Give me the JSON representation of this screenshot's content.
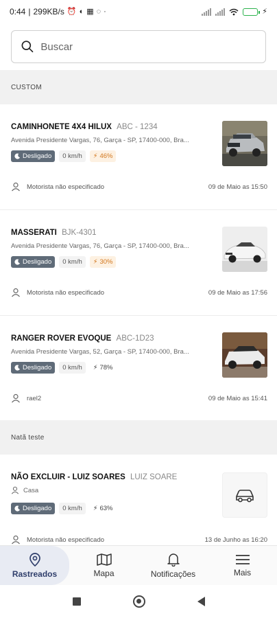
{
  "status_bar": {
    "time": "0:44",
    "net_speed": "299KB/s",
    "battery_level": 1.0,
    "icons": [
      "alarm-icon",
      "g-icon",
      "qr-icon",
      "whatsapp-icon",
      "dot-icon",
      "signal-icon",
      "signal-icon",
      "wifi-icon",
      "battery-icon",
      "charging-icon"
    ]
  },
  "search": {
    "placeholder": "Buscar",
    "value": ""
  },
  "groups": [
    {
      "label": "CUSTOM"
    },
    {
      "label": "Natã teste"
    }
  ],
  "vehicles": [
    {
      "name": "CAMINHONETE 4X4 HILUX",
      "plate": "ABC - 1234",
      "address": "Avenida Presidente Vargas, 76, Garça - SP, 17400-000, Bra...",
      "status": "Desligado",
      "speed": "0 km/h",
      "battery": "46%",
      "battery_low": true,
      "driver": "Motorista não especificado",
      "time": "09 de Maio as 15:50",
      "photo": "silver-pickup"
    },
    {
      "name": "MASSERATI",
      "plate": "BJK-4301",
      "address": "Avenida Presidente Vargas, 76, Garça - SP, 17400-000, Bra...",
      "status": "Desligado",
      "speed": "0 km/h",
      "battery": "30%",
      "battery_low": true,
      "driver": "Motorista não especificado",
      "time": "09 de Maio as 17:56",
      "photo": "white-sports-car"
    },
    {
      "name": "RANGER ROVER EVOQUE",
      "plate": "ABC-1D23",
      "address": "Avenida Presidente Vargas, 52, Garça - SP, 17400-000, Bra...",
      "status": "Desligado",
      "speed": "0 km/h",
      "battery": "78%",
      "battery_low": false,
      "driver": "rael2",
      "time": "09 de Maio as 15:41",
      "photo": "white-suv"
    },
    {
      "name": "NÃO EXCLUIR - LUIZ SOARES",
      "plate": "LUIZ SOARE",
      "sub": "Casa",
      "status": "Desligado",
      "speed": "0 km/h",
      "battery": "63%",
      "battery_low": false,
      "driver": "Motorista não especificado",
      "time": "13 de Junho as 16:20",
      "photo": "car-icon"
    }
  ],
  "bottom_nav": [
    {
      "label": "Rastreados",
      "icon": "location-pin-icon",
      "active": true
    },
    {
      "label": "Mapa",
      "icon": "map-icon",
      "active": false
    },
    {
      "label": "Notificações",
      "icon": "bell-icon",
      "active": false
    },
    {
      "label": "Mais",
      "icon": "menu-icon",
      "active": false
    }
  ],
  "colors": {
    "status_badge": "#5f6b78",
    "battery_low": "#d2781f",
    "nav_active": "#2f3e6b",
    "charge": "#2bb24c"
  }
}
